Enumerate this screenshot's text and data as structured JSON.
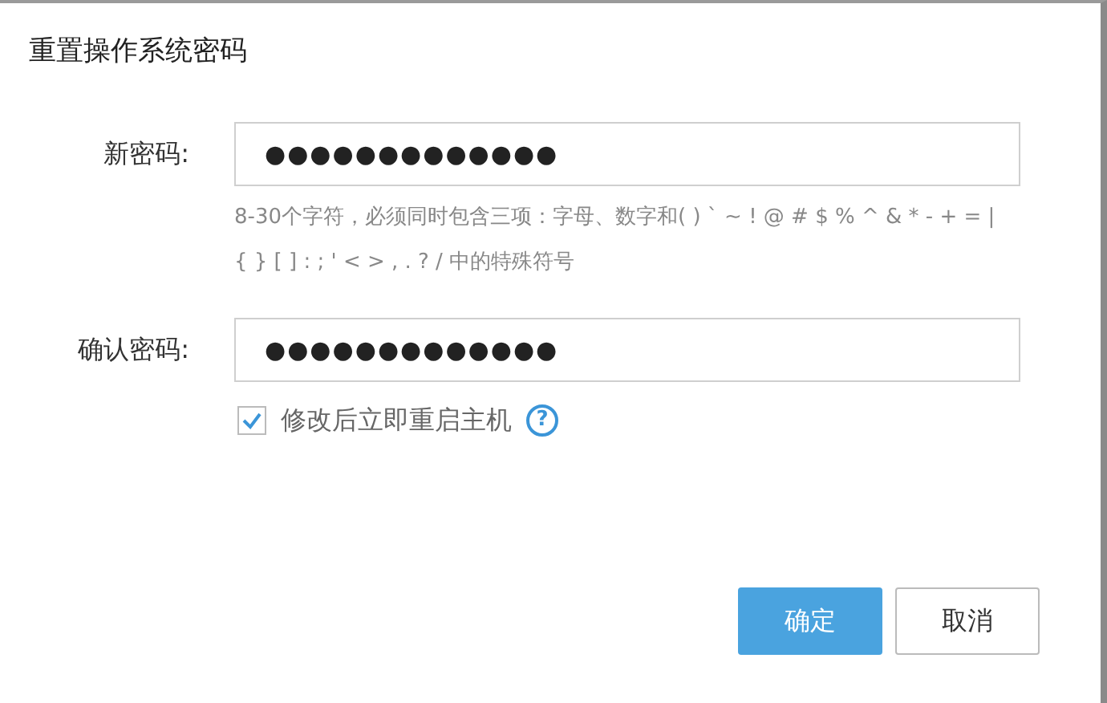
{
  "dialog": {
    "title": "重置操作系统密码"
  },
  "fields": [
    {
      "label": "新密码:",
      "value": "●●●●●●●●●●●●●",
      "hint": "8-30个字符，必须同时包含三项：字母、数字和( ) ` ~ ! @ # $ % ^ & * - + = | { } [ ] : ; ' < > , . ? / 中的特殊符号"
    },
    {
      "label": "确认密码:",
      "value": "●●●●●●●●●●●●●"
    }
  ],
  "restart": {
    "label": "修改后立即重启主机",
    "checked": true,
    "help": "?"
  },
  "buttons": [
    {
      "label": "确定",
      "kind": "primary"
    },
    {
      "label": "取消",
      "kind": "secondary"
    }
  ]
}
